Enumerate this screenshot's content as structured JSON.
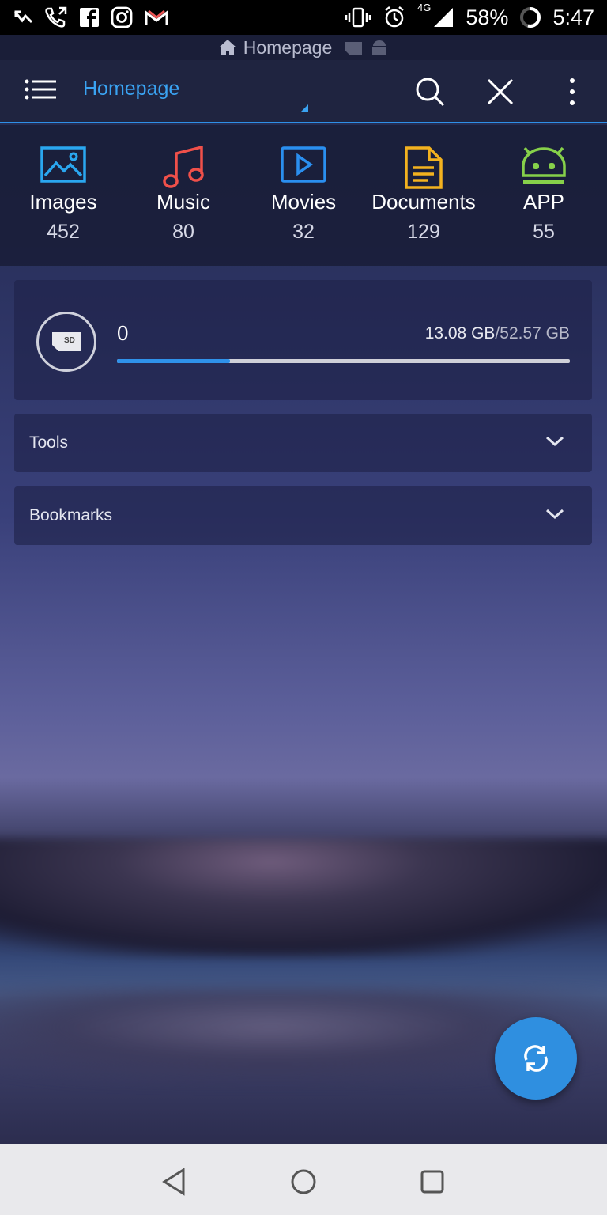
{
  "status_bar": {
    "battery": "58%",
    "network": "4G",
    "time": "5:47"
  },
  "path_bar": {
    "location": "Homepage"
  },
  "toolbar": {
    "title": "Homepage"
  },
  "categories": [
    {
      "label": "Images",
      "count": "452",
      "color": "#2aa7f0",
      "icon": "image-icon"
    },
    {
      "label": "Music",
      "count": "80",
      "color": "#f0504a",
      "icon": "music-icon"
    },
    {
      "label": "Movies",
      "count": "32",
      "color": "#2a8ff0",
      "icon": "video-icon"
    },
    {
      "label": "Documents",
      "count": "129",
      "color": "#f3b21f",
      "icon": "document-icon"
    },
    {
      "label": "APP",
      "count": "55",
      "color": "#86d04a",
      "icon": "android-icon"
    }
  ],
  "storage": {
    "name": "0",
    "used": "13.08 GB",
    "separator": "/",
    "total": "52.57 GB",
    "used_fraction": 0.25
  },
  "sections": {
    "tools": "Tools",
    "bookmarks": "Bookmarks"
  },
  "colors": {
    "accent": "#2e8fe6",
    "fab": "#2f8fe0"
  }
}
